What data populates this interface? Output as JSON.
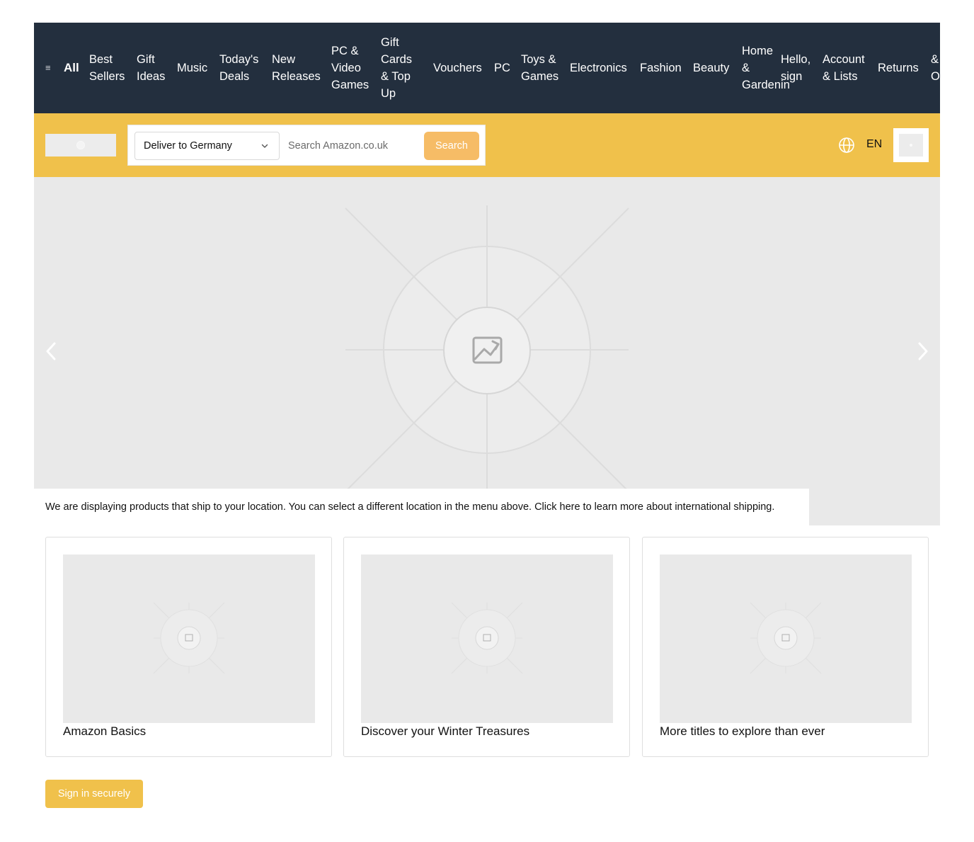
{
  "nav": {
    "menu_glyph": "≡",
    "all_label": "All",
    "items": [
      {
        "lines": [
          "Best",
          "Sellers"
        ]
      },
      {
        "lines": [
          "Gift",
          "Ideas"
        ]
      },
      {
        "lines": [
          "Music"
        ]
      },
      {
        "lines": [
          "Today's",
          "Deals"
        ]
      },
      {
        "lines": [
          "New",
          "Releases"
        ]
      },
      {
        "lines": [
          "PC &",
          "Video",
          "Games"
        ]
      },
      {
        "lines": [
          "Gift",
          "Cards",
          "& Top",
          "Up"
        ]
      },
      {
        "lines": [
          "Vouchers"
        ]
      },
      {
        "lines": [
          "PC"
        ]
      },
      {
        "lines": [
          "Toys &",
          "Games"
        ]
      },
      {
        "lines": [
          "Electronics"
        ]
      },
      {
        "lines": [
          "Fashion"
        ]
      },
      {
        "lines": [
          "Beauty"
        ]
      },
      {
        "lines": [
          "Home",
          "&",
          "Gardenin"
        ]
      },
      {
        "lines": [
          "Hello,",
          "sign"
        ]
      },
      {
        "lines": [
          "Account",
          "& Lists"
        ]
      },
      {
        "lines": [
          "Returns"
        ]
      },
      {
        "lines": [
          "&",
          "O"
        ]
      }
    ]
  },
  "header": {
    "deliver_label": "Deliver to Germany",
    "search_placeholder": "Search Amazon.co.uk",
    "search_button": "Search",
    "language": "EN",
    "icons": {
      "globe": "globe-icon",
      "chevron": "chevron-down-icon",
      "cart": "cart-icon"
    }
  },
  "hero": {
    "notice": "We are displaying products that ship to your location. You can select a different location in the menu above. Click here to learn more about international shipping.",
    "prev_icon": "chevron-left-icon",
    "next_icon": "chevron-right-icon"
  },
  "cards": [
    {
      "title": "Amazon Basics"
    },
    {
      "title": "Discover your Winter Treasures"
    },
    {
      "title": "More titles to explore than ever"
    }
  ],
  "signin_button": "Sign in securely",
  "colors": {
    "nav_bg": "#232f3e",
    "bar_bg": "#f0c14b",
    "search_button_bg": "#f6bc66",
    "placeholder_bg": "#e9e9e9"
  }
}
